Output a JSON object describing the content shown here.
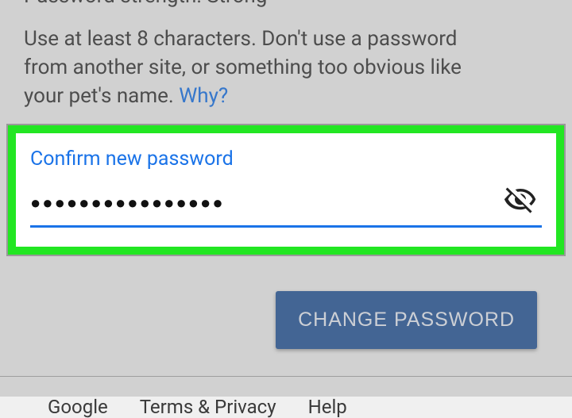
{
  "strength": {
    "partial_text": "Password strength: Strong"
  },
  "helper": {
    "line1": "Use at least 8 characters. Don't use a password",
    "line2": "from another site, or something too obvious like",
    "line3_prefix": "your pet's name. ",
    "why_link": "Why?"
  },
  "confirm_field": {
    "label": "Confirm new password",
    "masked_value": "●●●●●●●●●●●●●●●●"
  },
  "actions": {
    "change_password": "CHANGE PASSWORD"
  },
  "footer": {
    "google": "Google",
    "terms": "Terms & Privacy",
    "help": "Help"
  }
}
